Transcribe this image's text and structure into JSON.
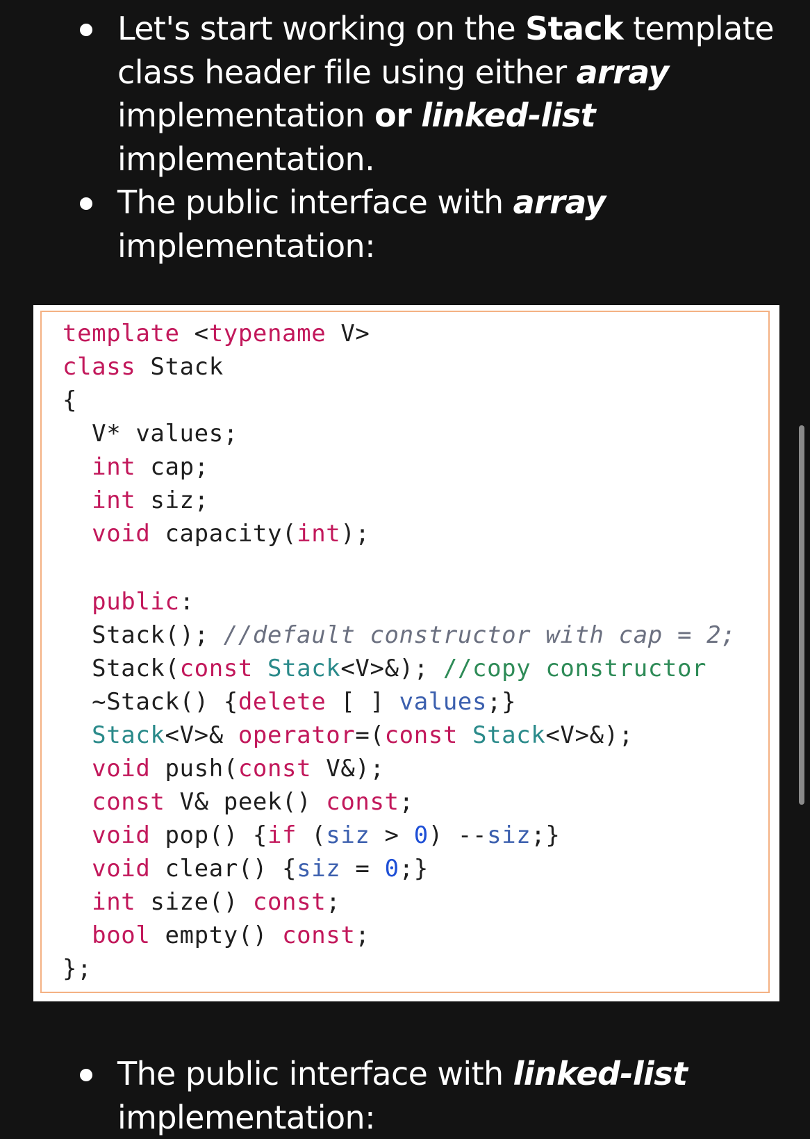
{
  "bullets_top": [
    {
      "parts": [
        {
          "text": "Let's start working on the ",
          "style": "normal"
        },
        {
          "text": "Stack",
          "style": "bold"
        },
        {
          "text": " template class header file using either ",
          "style": "normal"
        },
        {
          "text": "array",
          "style": "italic"
        },
        {
          "text": " implementation ",
          "style": "normal"
        },
        {
          "text": "or",
          "style": "bold"
        },
        {
          "text": " ",
          "style": "normal"
        },
        {
          "text": "linked-list",
          "style": "italic"
        },
        {
          "text": " implementation.",
          "style": "normal"
        }
      ]
    },
    {
      "parts": [
        {
          "text": "The public interface with ",
          "style": "normal"
        },
        {
          "text": "array",
          "style": "italic"
        },
        {
          "text": " implementation:",
          "style": "normal"
        }
      ]
    }
  ],
  "code_lines": [
    [
      {
        "t": "template",
        "c": "kw"
      },
      {
        "t": " <",
        "c": ""
      },
      {
        "t": "typename",
        "c": "kw"
      },
      {
        "t": " V>",
        "c": ""
      }
    ],
    [
      {
        "t": "class",
        "c": "kw"
      },
      {
        "t": " Stack",
        "c": ""
      }
    ],
    [
      {
        "t": "{",
        "c": ""
      }
    ],
    [
      {
        "t": "  V* values;",
        "c": ""
      }
    ],
    [
      {
        "t": "  ",
        "c": ""
      },
      {
        "t": "int",
        "c": "kw"
      },
      {
        "t": " cap;",
        "c": ""
      }
    ],
    [
      {
        "t": "  ",
        "c": ""
      },
      {
        "t": "int",
        "c": "kw"
      },
      {
        "t": " siz;",
        "c": ""
      }
    ],
    [
      {
        "t": "  ",
        "c": ""
      },
      {
        "t": "void",
        "c": "kw"
      },
      {
        "t": " capacity(",
        "c": ""
      },
      {
        "t": "int",
        "c": "kw"
      },
      {
        "t": ");",
        "c": ""
      }
    ],
    [],
    [
      {
        "t": "  ",
        "c": ""
      },
      {
        "t": "public",
        "c": "kw"
      },
      {
        "t": ":",
        "c": ""
      }
    ],
    [
      {
        "t": "  Stack(); ",
        "c": ""
      },
      {
        "t": "//default constructor with cap = 2;",
        "c": "cm"
      }
    ],
    [
      {
        "t": "  Stack(",
        "c": ""
      },
      {
        "t": "const",
        "c": "kw"
      },
      {
        "t": " ",
        "c": ""
      },
      {
        "t": "Stack",
        "c": "ty"
      },
      {
        "t": "<V>&); ",
        "c": ""
      },
      {
        "t": "//copy constructor",
        "c": "cg"
      }
    ],
    [
      {
        "t": "  ~Stack() {",
        "c": ""
      },
      {
        "t": "delete",
        "c": "kw"
      },
      {
        "t": " [ ] ",
        "c": ""
      },
      {
        "t": "values",
        "c": "vr"
      },
      {
        "t": ";}",
        "c": ""
      }
    ],
    [
      {
        "t": "  ",
        "c": ""
      },
      {
        "t": "Stack",
        "c": "ty"
      },
      {
        "t": "<V>& ",
        "c": ""
      },
      {
        "t": "operator",
        "c": "kw"
      },
      {
        "t": "=(",
        "c": ""
      },
      {
        "t": "const",
        "c": "kw"
      },
      {
        "t": " ",
        "c": ""
      },
      {
        "t": "Stack",
        "c": "ty"
      },
      {
        "t": "<V>&);",
        "c": ""
      }
    ],
    [
      {
        "t": "  ",
        "c": ""
      },
      {
        "t": "void",
        "c": "kw"
      },
      {
        "t": " push(",
        "c": ""
      },
      {
        "t": "const",
        "c": "kw"
      },
      {
        "t": " V&);",
        "c": ""
      }
    ],
    [
      {
        "t": "  ",
        "c": ""
      },
      {
        "t": "const",
        "c": "kw"
      },
      {
        "t": " V& peek() ",
        "c": ""
      },
      {
        "t": "const",
        "c": "kw"
      },
      {
        "t": ";",
        "c": ""
      }
    ],
    [
      {
        "t": "  ",
        "c": ""
      },
      {
        "t": "void",
        "c": "kw"
      },
      {
        "t": " pop() {",
        "c": ""
      },
      {
        "t": "if",
        "c": "kw"
      },
      {
        "t": " (",
        "c": ""
      },
      {
        "t": "siz",
        "c": "vr"
      },
      {
        "t": " > ",
        "c": ""
      },
      {
        "t": "0",
        "c": "num"
      },
      {
        "t": ") --",
        "c": ""
      },
      {
        "t": "siz",
        "c": "vr"
      },
      {
        "t": ";}",
        "c": ""
      }
    ],
    [
      {
        "t": "  ",
        "c": ""
      },
      {
        "t": "void",
        "c": "kw"
      },
      {
        "t": " clear() {",
        "c": ""
      },
      {
        "t": "siz",
        "c": "vr"
      },
      {
        "t": " = ",
        "c": ""
      },
      {
        "t": "0",
        "c": "num"
      },
      {
        "t": ";}",
        "c": ""
      }
    ],
    [
      {
        "t": "  ",
        "c": ""
      },
      {
        "t": "int",
        "c": "kw"
      },
      {
        "t": " size() ",
        "c": ""
      },
      {
        "t": "const",
        "c": "kw"
      },
      {
        "t": ";",
        "c": ""
      }
    ],
    [
      {
        "t": "  ",
        "c": ""
      },
      {
        "t": "bool",
        "c": "kw"
      },
      {
        "t": " empty() ",
        "c": ""
      },
      {
        "t": "const",
        "c": "kw"
      },
      {
        "t": ";",
        "c": ""
      }
    ],
    [
      {
        "t": "};",
        "c": ""
      }
    ]
  ],
  "bullets_bottom": [
    {
      "parts": [
        {
          "text": "The public interface with ",
          "style": "normal"
        },
        {
          "text": "linked-list",
          "style": "italic"
        },
        {
          "text": " implementation:",
          "style": "normal"
        }
      ]
    }
  ],
  "colors": {
    "background": "#131313",
    "text": "#ffffff",
    "code_panel": "#ffffff",
    "code_border": "#f4b183",
    "keyword": "#c2185b",
    "type": "#2a8a8a",
    "variable": "#3b5fae",
    "number": "#1e4fd6",
    "comment": "#6b7080",
    "comment_green": "#2e8b57"
  }
}
